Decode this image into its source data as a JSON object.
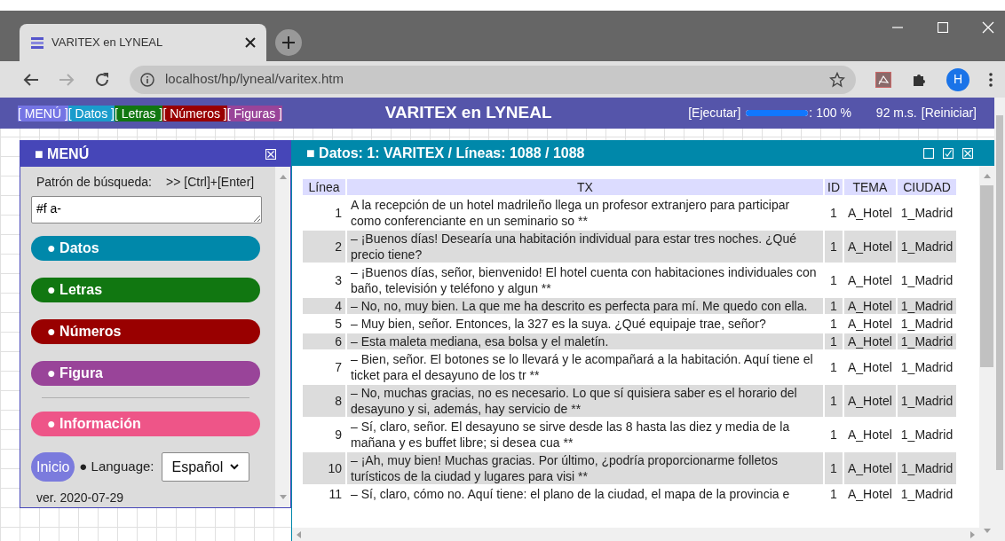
{
  "browser": {
    "tab_title": "VARITEX en LYNEAL",
    "url": "localhost/hp/lyneal/varitex.htm",
    "profile_initial": "H"
  },
  "header": {
    "nav": [
      {
        "label": "[ MENÚ ]",
        "color": "#7474e4"
      },
      {
        "label": "[ Datos ]",
        "color": "#1a9ccc"
      },
      {
        "label": "[ Letras ]",
        "color": "#117711"
      },
      {
        "label": "[ Números ]",
        "color": "#990000"
      },
      {
        "label": "[ Figuras ]",
        "color": "#994499"
      }
    ],
    "title": "VARITEX en LYNEAL",
    "run": "[Ejecutar]",
    "progress": {
      "level": 1,
      "reading": ": 100 %"
    },
    "time": "92 m.s.",
    "reset": "[Reiniciar]"
  },
  "menu_panel": {
    "title": "■ MENÚ",
    "search_label": "Patrón de búsqueda:",
    "search_hint": ">> [Ctrl]+[Enter]",
    "search_value": "#f a-",
    "buttons": [
      {
        "label": "● Datos",
        "color": "#0088aa"
      },
      {
        "label": "● Letras",
        "color": "#117711"
      },
      {
        "label": "● Números",
        "color": "#990000"
      },
      {
        "label": "● Figura",
        "color": "#994499"
      }
    ],
    "info_button": {
      "label": "● Información",
      "color": "#ee5588"
    },
    "home_button": "Inicio",
    "language_label": "● Language:",
    "language": "Español",
    "version": "ver. 2020-07-29"
  },
  "data_panel": {
    "title": "■ Datos: 1: VARITEX / Líneas: 1088 / 1088",
    "table": {
      "columns": [
        "Línea",
        "TX",
        "ID",
        "TEMA",
        "CIUDAD"
      ],
      "rows": [
        [
          "1",
          "A la recepción de un hotel madrileño llega un profesor extranjero para participar como conferenciante en un seminario so **",
          "1",
          "A_Hotel",
          "1_Madrid"
        ],
        [
          "2",
          "– ¡Buenos días! Desearía una habitación individual para estar tres noches. ¿Qué precio tiene?",
          "1",
          "A_Hotel",
          "1_Madrid"
        ],
        [
          "3",
          "– ¡Buenos días, señor, bienvenido! El hotel cuenta con habitaciones individuales con baño, televisión y teléfono y algun **",
          "1",
          "A_Hotel",
          "1_Madrid"
        ],
        [
          "4",
          "– No, no, muy bien. La que me ha descrito es perfecta para mí. Me quedo con ella.",
          "1",
          "A_Hotel",
          "1_Madrid"
        ],
        [
          "5",
          "– Muy bien, señor. Entonces, la 327 es la suya. ¿Qué equipaje trae, señor?",
          "1",
          "A_Hotel",
          "1_Madrid"
        ],
        [
          "6",
          "– Esta maleta mediana, esa bolsa y el maletín.",
          "1",
          "A_Hotel",
          "1_Madrid"
        ],
        [
          "7",
          "– Bien, señor. El botones se lo llevará y le acompañará a la habitación. Aquí tiene el ticket para el desayuno de los tr **",
          "1",
          "A_Hotel",
          "1_Madrid"
        ],
        [
          "8",
          "– No, muchas gracias, no es necesario. Lo que sí quisiera saber es el horario del desayuno y si, además, hay servicio de **",
          "1",
          "A_Hotel",
          "1_Madrid"
        ],
        [
          "9",
          "– Sí, claro, señor. El desayuno se sirve desde las 8 hasta las diez y media de la mañana y es buffet libre; si desea cua **",
          "1",
          "A_Hotel",
          "1_Madrid"
        ],
        [
          "10",
          "– ¡Ah, muy bien! Muchas gracias. Por último, ¿podría proporcionarme folletos turísticos de la ciudad y lugares para visi **",
          "1",
          "A_Hotel",
          "1_Madrid"
        ],
        [
          "11",
          "– Sí, claro, cómo no. Aquí tiene: el plano de la ciudad, el mapa de la provincia e",
          "1",
          "A_Hotel",
          "1_Madrid"
        ]
      ]
    }
  }
}
